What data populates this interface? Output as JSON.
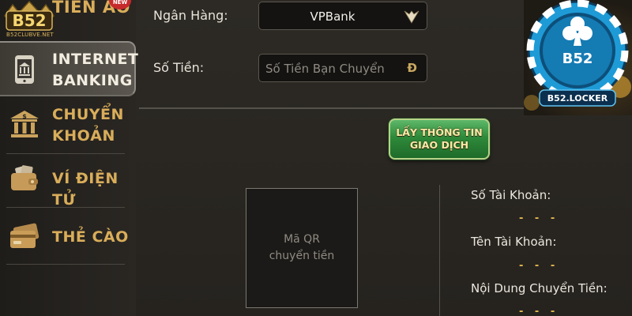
{
  "logo": {
    "text": "B52",
    "sub": "B52CLUBVE.NET"
  },
  "sidebar": {
    "items": [
      {
        "label": "TIỀN ẢO",
        "badge": "NEW"
      },
      {
        "label": "INTERNET BANKING",
        "line1": "INTERNET",
        "line2": "BANKING",
        "active": true
      },
      {
        "label": "CHUYỂN KHOẢN",
        "line1": "CHUYỂN",
        "line2": "KHOẢN"
      },
      {
        "label": "VÍ ĐIỆN TỬ"
      },
      {
        "label": "THẺ CÀO"
      }
    ]
  },
  "form": {
    "bank_label": "Ngân Hàng:",
    "bank_value": "VPBank",
    "amount_label": "Số Tiền:",
    "amount_placeholder": "Số Tiền Bạn Chuyển",
    "currency_symbol": "Đ"
  },
  "action": {
    "line1": "LẤY THÔNG TIN",
    "line2": "GIAO DỊCH"
  },
  "qr": {
    "line1": "Mã QR",
    "line2": "chuyển tiền"
  },
  "info": {
    "account_number_label": "Số Tài Khoản:",
    "account_number_value": "- - -",
    "account_name_label": "Tên Tài Khoản:",
    "account_name_value": "- - -",
    "content_label": "Nội Dung Chuyển Tiền:",
    "content_value": "- - -"
  },
  "brand": {
    "name": "B52",
    "tag": "B52.LOCKER"
  },
  "colors": {
    "accent_gold": "#d9ad5a",
    "button_green": "#2e8a3a",
    "brand_blue": "#1e9bd6"
  }
}
